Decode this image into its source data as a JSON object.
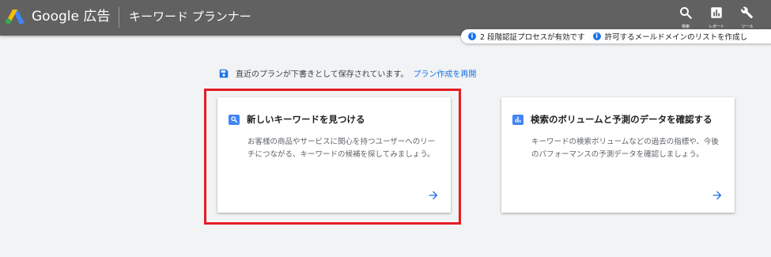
{
  "header": {
    "brand": "Google 広告",
    "page_title": "キーワード プランナー",
    "tools": [
      {
        "label": "検索",
        "icon": "search-icon"
      },
      {
        "label": "レポート",
        "icon": "bar-chart-icon"
      },
      {
        "label": "ツール",
        "icon": "wrench-icon"
      }
    ]
  },
  "notifications": [
    {
      "text": "2 段階認証プロセスが有効です",
      "icon": "info-icon"
    },
    {
      "text": "許可するメールドメインのリストを作成し",
      "icon": "info-icon"
    }
  ],
  "draft": {
    "text": "直近のプランが下書きとして保存されています。",
    "link": "プラン作成を再開",
    "icon": "save-icon"
  },
  "cards": [
    {
      "title": "新しいキーワードを見つける",
      "description": "お客様の商品やサービスに関心を持つユーザーへのリーチにつながる、キーワードの候補を探してみましょう。",
      "icon": "search-icon"
    },
    {
      "title": "検索のボリュームと予測のデータを確認する",
      "description": "キーワードの検索ボリュームなどの過去の指標や、今後のパフォーマンスの予測データを確認しましょう。",
      "icon": "bar-chart-icon"
    }
  ],
  "colors": {
    "header_bg": "#616161",
    "accent": "#1a73e8",
    "highlight": "#e51c23",
    "page_bg": "#f1f3f4"
  }
}
